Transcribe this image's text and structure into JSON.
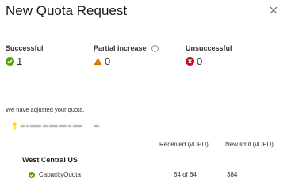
{
  "dialog": {
    "title": "New Quota Request",
    "message": "We have adjusted your quota."
  },
  "summary": {
    "successful": {
      "label": "Successful",
      "count": "1",
      "icon": "check-circle-icon",
      "color": "#57a300"
    },
    "partial": {
      "label": "Partial increase",
      "count": "0",
      "icon": "warning-triangle-icon",
      "color": "#db7500"
    },
    "unsuccessful": {
      "label": "Unsuccessful",
      "count": "0",
      "icon": "error-circle-icon",
      "color": "#c50f1f"
    }
  },
  "account": {
    "icon": "key-icon",
    "color": "#fcd116"
  },
  "table": {
    "columns": [
      "Received (vCPU)",
      "New limit (vCPU)"
    ],
    "region": "West Central US",
    "rows": [
      {
        "name": "CapacityQuota",
        "received": "64 of 64",
        "new_limit": "384",
        "status_icon": "check-circle-icon"
      }
    ]
  }
}
